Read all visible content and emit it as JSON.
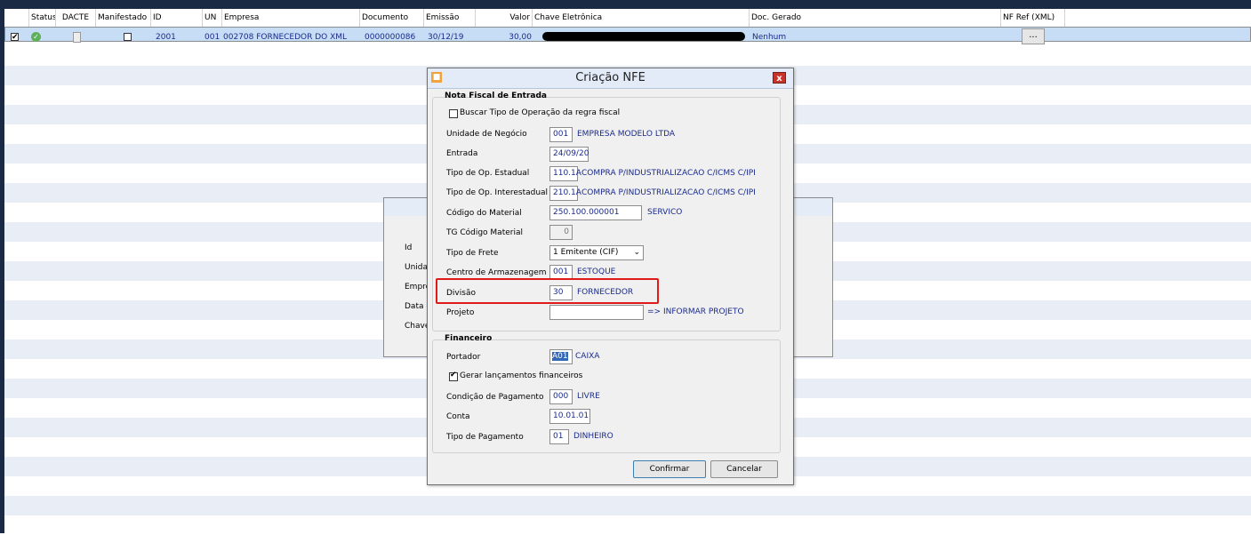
{
  "grid": {
    "headers": [
      "Status",
      "DACTE",
      "Manifestado",
      "ID",
      "UN",
      "Empresa",
      "Documento",
      "Emissão",
      "Valor",
      "Chave Eletrônica",
      "Doc. Gerado",
      "NF Ref (XML)"
    ],
    "row": {
      "id": "2001",
      "un": "001",
      "empresa": "002708  FORNECEDOR DO XML",
      "documento": "0000000086",
      "emissao": "30/12/19",
      "valor": "30,00",
      "doc_gerado": "Nenhum",
      "nf_ref_button": "...",
      "status_color": "#5fb05a"
    }
  },
  "background_panel": {
    "labels": [
      "Id",
      "Unidac",
      "Empre",
      "Data c",
      "Chave"
    ]
  },
  "dialog": {
    "title": "Criação NFE",
    "close": "x",
    "nota": {
      "title": "Nota Fiscal de Entrada",
      "buscar_checkbox": "Buscar Tipo de Operação da regra fiscal",
      "unidade_label": "Unidade de Negócio",
      "unidade_code": "001",
      "unidade_desc": "EMPRESA MODELO LTDA",
      "entrada_label": "Entrada",
      "entrada_value": "24/09/20",
      "tipo_est_label": "Tipo de Op. Estadual",
      "tipo_est_code": "110.1A",
      "tipo_est_desc": "COMPRA P/INDUSTRIALIZACAO C/ICMS C/IPI",
      "tipo_inter_label": "Tipo de Op. Interestadual",
      "tipo_inter_code": "210.1A",
      "tipo_inter_desc": "COMPRA P/INDUSTRIALIZACAO C/ICMS C/IPI",
      "material_label": "Código do Material",
      "material_code": "250.100.000001",
      "material_desc": "SERVICO",
      "tg_label": "TG Código Material",
      "tg_value": "0",
      "frete_label": "Tipo de Frete",
      "frete_value": "1 Emitente (CIF)",
      "centro_label": "Centro de Armazenagem",
      "centro_code": "001",
      "centro_desc": "ESTOQUE",
      "divisao_label": "Divisão",
      "divisao_code": "30",
      "divisao_desc": "FORNECEDOR",
      "projeto_label": "Projeto",
      "projeto_value": "",
      "projeto_link": "=> INFORMAR PROJETO"
    },
    "financeiro": {
      "title": "Financeiro",
      "portador_label": "Portador",
      "portador_code": "A01",
      "portador_desc": "CAIXA",
      "gerar_checkbox": "Gerar lançamentos financeiros",
      "condicao_label": "Condição de Pagamento",
      "condicao_code": "000",
      "condicao_desc": "LIVRE",
      "conta_label": "Conta",
      "conta_value": "10.01.01",
      "tipo_pag_label": "Tipo de Pagamento",
      "tipo_pag_code": "01",
      "tipo_pag_desc": "DINHEIRO"
    },
    "buttons": {
      "confirmar": "Confirmar",
      "cancelar": "Cancelar"
    },
    "highlight_color": "#e01919"
  }
}
